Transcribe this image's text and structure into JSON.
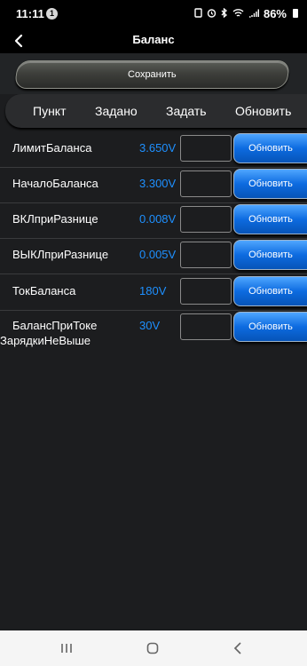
{
  "status": {
    "time": "11:11",
    "notification_count": "1",
    "battery": "86%"
  },
  "header": {
    "title": "Баланс"
  },
  "save_button": {
    "label": "Сохранить"
  },
  "columns": {
    "item": "Пункт",
    "set": "Задано",
    "assign": "Задать",
    "update": "Обновить"
  },
  "params": [
    {
      "name": "ЛимитБаланса",
      "value": "3.650V",
      "update_label": "Обновить"
    },
    {
      "name": "НачалоБаланса",
      "value": "3.300V",
      "update_label": "Обновить"
    },
    {
      "name": "ВКЛприРазнице",
      "value": "0.008V",
      "update_label": "Обновить"
    },
    {
      "name": "ВЫКЛприРазнице",
      "value": "0.005V",
      "update_label": "Обновить"
    },
    {
      "name": "ТокБаланса",
      "value": "180V",
      "update_label": "Обновить"
    },
    {
      "name": "БалансПриТоке",
      "name_line2": "ЗарядкиНеВыше",
      "value": "30V",
      "update_label": "Обновить"
    }
  ],
  "colors": {
    "value_blue": "#1e90ff",
    "button_blue": "#0d6be0",
    "background": "#1c1d1f"
  }
}
